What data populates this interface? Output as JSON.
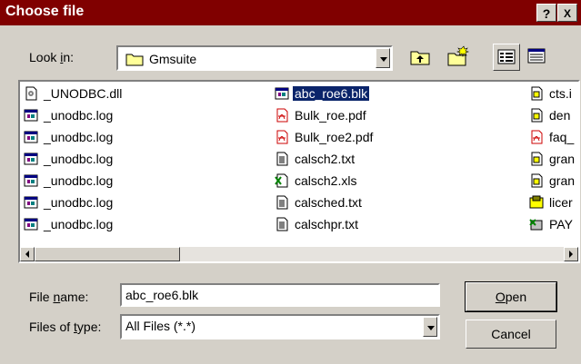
{
  "window": {
    "title": "Choose file",
    "help_button": "?",
    "close_button": "X"
  },
  "look_in": {
    "label_pre": "Look ",
    "label_accel": "i",
    "label_post": "n:",
    "value": "Gmsuite"
  },
  "toolbar": [
    {
      "name": "up-one-level-button",
      "icon": "folder-up-icon"
    },
    {
      "name": "create-new-folder-button",
      "icon": "new-folder-icon"
    },
    {
      "name": "list-view-button",
      "icon": "list-view-icon"
    },
    {
      "name": "details-view-button",
      "icon": "details-view-icon"
    }
  ],
  "files": {
    "col1": [
      "_UNODBC.dll",
      "_unodbc.log",
      "_unodbc.log",
      "_unodbc.log",
      "_unodbc.log",
      "_unodbc.log",
      "_unodbc.log"
    ],
    "col2": [
      "abc_roe6.blk",
      "Bulk_roe.pdf",
      "Bulk_roe2.pdf",
      "calsch2.txt",
      "calsch2.xls",
      "calsched.txt",
      "calschpr.txt"
    ],
    "col3": [
      "cts.i",
      "den",
      "faq_",
      "gran",
      "gran",
      "licer",
      "PAY"
    ],
    "selected": "abc_roe6.blk"
  },
  "file_name": {
    "label_pre": "File ",
    "label_accel": "n",
    "label_post": "ame:",
    "value": "abc_roe6.blk"
  },
  "file_type": {
    "label_pre": "Files of ",
    "label_accel": "t",
    "label_post": "ype:",
    "value": "All Files (*.*)"
  },
  "buttons": {
    "open_accel": "O",
    "open_rest": "pen",
    "cancel": "Cancel"
  }
}
